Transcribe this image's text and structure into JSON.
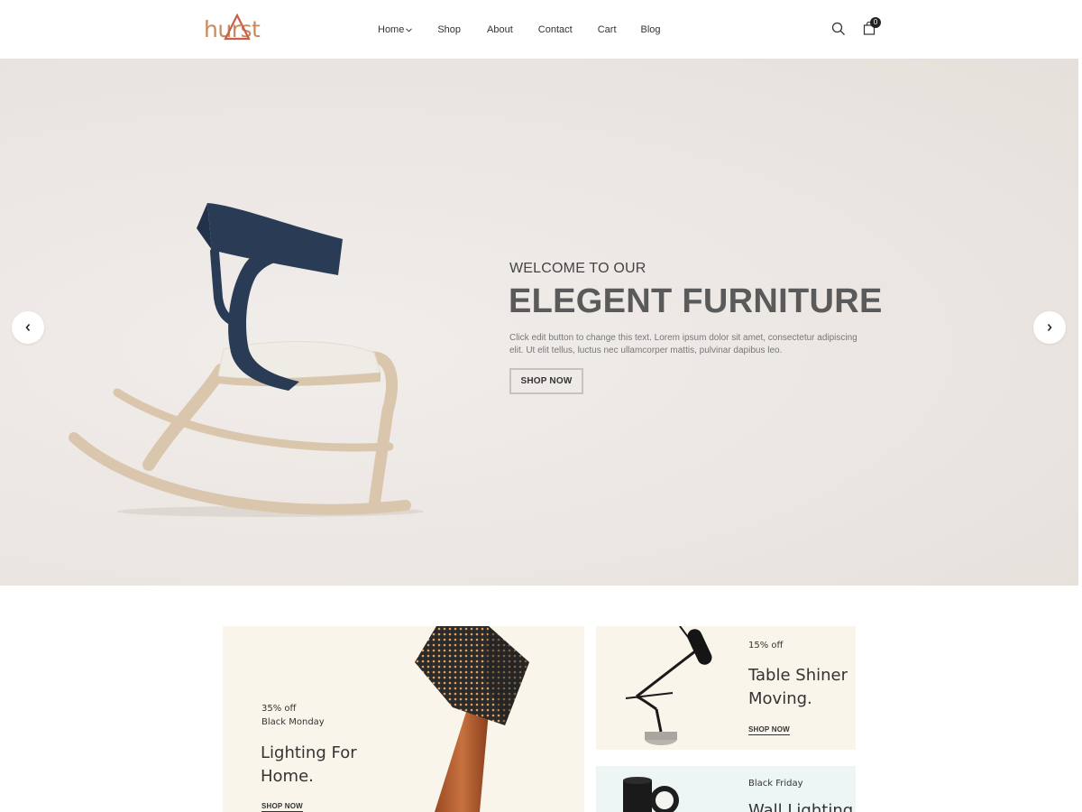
{
  "header": {
    "logo_text": "hurst",
    "nav": [
      {
        "label": "Home",
        "has_dropdown": true
      },
      {
        "label": "Shop"
      },
      {
        "label": "About"
      },
      {
        "label": "Contact"
      },
      {
        "label": "Cart"
      },
      {
        "label": "Blog"
      }
    ],
    "cart_count": "0",
    "icons": [
      "search-icon",
      "shopping-bag-icon"
    ]
  },
  "hero": {
    "eyebrow": "WELCOME TO OUR",
    "title": "ELEGENT FURNITURE",
    "description": "Click edit button to change this text. Lorem ipsum dolor sit amet, consectetur adipiscing elit. Ut elit tellus, luctus nec ullamcorper mattis, pulvinar dapibus leo.",
    "cta": "SHOP NOW",
    "prev_icon": "chevron-left-icon",
    "next_icon": "chevron-right-icon"
  },
  "banners": {
    "large": {
      "discount": "35% off",
      "subtitle": "Black Monday",
      "title_line1": "Lighting For",
      "title_line2": "Home.",
      "link": "SHOP NOW"
    },
    "small1": {
      "discount": "15% off",
      "title_line1": "Table Shiner",
      "title_line2": "Moving.",
      "link": "SHOP NOW"
    },
    "small2": {
      "subtitle": "Black Friday",
      "title_line1": "Wall Lighting"
    }
  },
  "colors": {
    "logo": "#c98a5c",
    "hero_bg": "#ece7e3",
    "banner_cream": "#f9f5ea",
    "banner_mint": "#eef5f5",
    "chair_navy": "#2a3c55",
    "wood": "#d9c6ad"
  }
}
